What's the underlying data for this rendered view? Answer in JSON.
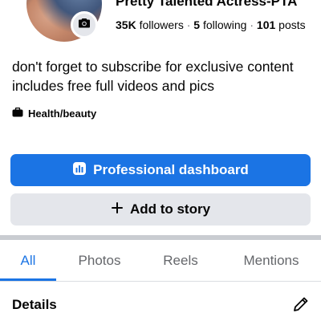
{
  "profile": {
    "name": "Pretty Talented Actress-PTA",
    "followers_count": "35K",
    "followers_label": "followers",
    "following_count": "5",
    "following_label": "following",
    "posts_count": "101",
    "posts_label": "posts",
    "separator": "·",
    "bio": "don't forget to subscribe for exclusive content includes free full videos and pics",
    "category": "Health/beauty"
  },
  "actions": {
    "dashboard_label": "Professional dashboard",
    "add_story_label": "Add to story"
  },
  "tabs": [
    {
      "label": "All",
      "active": true
    },
    {
      "label": "Photos",
      "active": false
    },
    {
      "label": "Reels",
      "active": false
    },
    {
      "label": "Mentions",
      "active": false
    }
  ],
  "details": {
    "title": "Details"
  },
  "colors": {
    "accent": "#1b74e4",
    "secondary_button": "#e4e6eb",
    "muted_text": "#65676b"
  },
  "icons": {
    "camera": "camera-icon",
    "category": "briefcase-icon",
    "dashboard": "bar-chart-icon",
    "add": "plus-icon",
    "edit": "pencil-icon"
  }
}
